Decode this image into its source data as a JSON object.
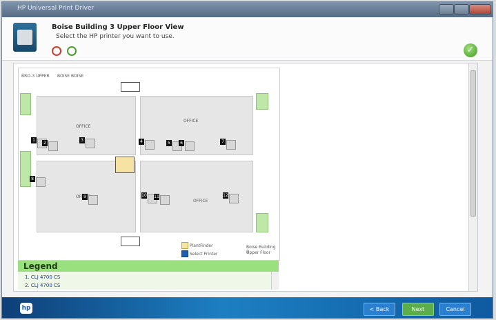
{
  "window": {
    "title": "HP Universal Print Driver"
  },
  "header": {
    "title": "Boise Building 3 Upper Floor View",
    "subtitle": "Select the HP printer you want to use.",
    "back_icon": "undo-icon",
    "refresh_icon": "refresh-icon",
    "status_icon": "checkmark-icon"
  },
  "map": {
    "top_labels": [
      "BRO-3 UPPER",
      "BOISE BOISE"
    ],
    "rooms": [
      "OFFICE",
      "OFFICE",
      "OFFICE",
      "OFFICE"
    ],
    "printer_numbers": [
      "1",
      "2",
      "3",
      "4",
      "5",
      "6",
      "7",
      "8",
      "9",
      "10",
      "11",
      "12"
    ],
    "key": {
      "row1": "PlantFinder",
      "row2": "Select Printer"
    },
    "notes": [
      "Boise Building 3",
      "Upper Floor"
    ]
  },
  "legend": {
    "title": "Legend",
    "items": [
      "1.  CLJ 4700 CS",
      "2.  CLJ 4700 CS"
    ]
  },
  "footer": {
    "logo": "hp",
    "back": "< Back",
    "next": "Next",
    "cancel": "Cancel"
  },
  "colors": {
    "accent_green": "#9be07e",
    "footer_blue": "#1d7fc2"
  }
}
